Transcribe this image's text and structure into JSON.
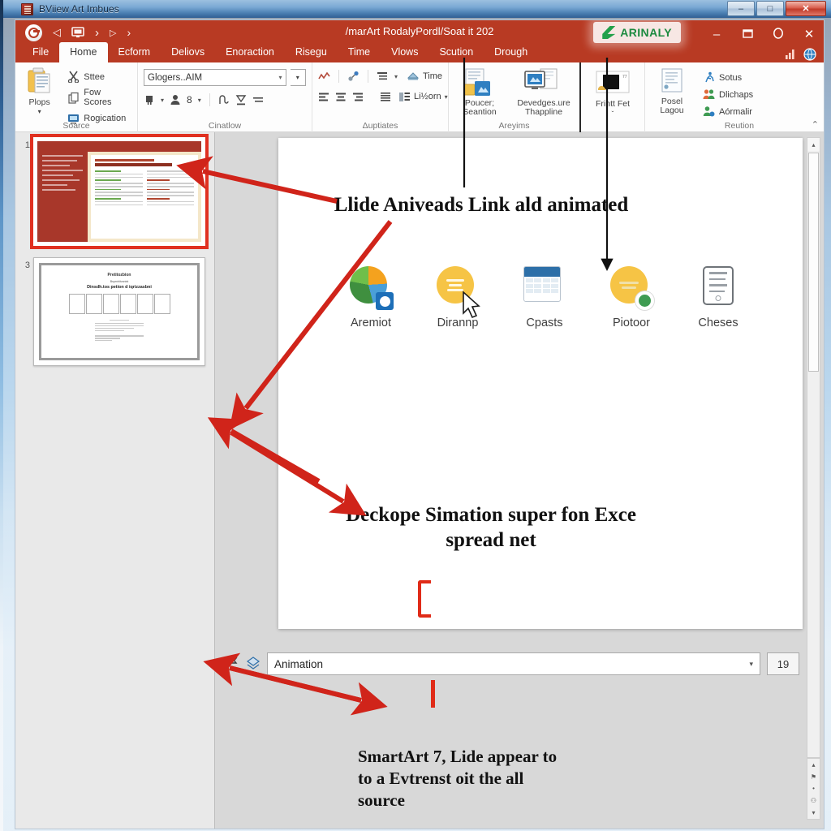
{
  "os_window": {
    "title": "BViiew Art Imbues",
    "icon": "app-icon",
    "buttons": [
      {
        "name": "minimize",
        "glyph": "–"
      },
      {
        "name": "maximize",
        "glyph": "□"
      },
      {
        "name": "close",
        "glyph": "✕"
      }
    ]
  },
  "ribbon": {
    "document_title": "/marArt RodalyPordl/Soat it 202",
    "account_badge": {
      "label": "ARINALY",
      "color": "#1c8a3f"
    },
    "quick_access": [
      {
        "name": "ppt-logo-icon",
        "glyph": ""
      },
      {
        "name": "undo-icon",
        "glyph": "◁"
      },
      {
        "name": "present-icon",
        "glyph": "⬜"
      },
      {
        "name": "redo-icon",
        "glyph": "›"
      },
      {
        "name": "slideshow-icon",
        "glyph": "▷"
      },
      {
        "name": "more-icon",
        "glyph": "›"
      }
    ],
    "window_controls": [
      {
        "name": "minimize-icon",
        "glyph": "–"
      },
      {
        "name": "restore-icon",
        "glyph": "❐"
      },
      {
        "name": "help-icon",
        "glyph": "◌"
      },
      {
        "name": "close-icon",
        "glyph": "✕"
      }
    ],
    "tabs": [
      {
        "label": "File",
        "active": false
      },
      {
        "label": "Home",
        "active": true
      },
      {
        "label": "Ecform",
        "active": false
      },
      {
        "label": "Deliovs",
        "active": false
      },
      {
        "label": "Enoraction",
        "active": false
      },
      {
        "label": "Risegu",
        "active": false
      },
      {
        "label": "Time",
        "active": false
      },
      {
        "label": "Vlows",
        "active": false
      },
      {
        "label": "Scution",
        "active": false
      },
      {
        "label": "Drough",
        "active": false
      }
    ],
    "collapse_glyph": "⌃",
    "groups": [
      {
        "name": "source",
        "label": "Soarce",
        "big_button": {
          "label": "Plops",
          "caret": "▾"
        },
        "items": [
          {
            "label": "Sttee",
            "icon": "cut-icon"
          },
          {
            "label": "Fow Scores",
            "icon": "copy-icon"
          },
          {
            "label": "Rogication",
            "icon": "paste-icon"
          }
        ]
      },
      {
        "name": "cinatlow",
        "label": "Cinatlow",
        "combo_value": "Glogers..AIM",
        "combo_caret": "▾",
        "combo_more": "▾",
        "tools": [
          "bold-icon",
          "caret-icon",
          "person-icon",
          "size-icon",
          "caret-icon",
          "shape-icon",
          "fill-icon",
          "spacing-icon"
        ]
      },
      {
        "name": "auptiates",
        "label": "Δuptiates",
        "row1": [
          "chart-line-icon",
          "link-icon",
          "list-icon",
          "caret-icon"
        ],
        "row1_text": "Time",
        "row2": [
          "align-left-icon",
          "align-center-icon",
          "align-right-icon",
          "justify-icon",
          "columns-icon"
        ],
        "row2_text": "Li½orn",
        "row2_caret": "▾"
      },
      {
        "name": "areyims",
        "label": "Areyims",
        "buttons": [
          {
            "label": "Poucer; Seantion",
            "icon": "insert-object-icon"
          },
          {
            "label": "Devedges.ure Thappline",
            "icon": "screen-clip-icon"
          }
        ]
      },
      {
        "name": "frint-fet",
        "label": "",
        "buttons": [
          {
            "label": "Frintt Fet",
            "icon": "black-shape-icon",
            "caret": "ˇ"
          }
        ]
      },
      {
        "name": "reution",
        "label": "Reution",
        "big_button": {
          "label": "Posel Lagou"
        },
        "items": [
          {
            "label": "Sotus",
            "icon": "run-icon"
          },
          {
            "label": "Dlichaps",
            "icon": "people-icon"
          },
          {
            "label": "Aórmalir",
            "icon": "person-gear-icon"
          }
        ]
      }
    ]
  },
  "thumbnails": [
    {
      "number": "1",
      "selected": true,
      "style": "red-sidebar-deck"
    },
    {
      "number": "3",
      "selected": false,
      "style": "white-table-deck"
    }
  ],
  "slide": {
    "annotation_top": "Llide Aniveads Link ald animated",
    "annotation_mid": "Deckope Simation super fon Exce spread net",
    "icon_row": [
      {
        "caption": "Aremiot",
        "icon": "pie-chart-icon"
      },
      {
        "caption": "Dirannp",
        "icon": "yellow-document-icon"
      },
      {
        "caption": "Cpasts",
        "icon": "calendar-icon"
      },
      {
        "caption": "Piotoor",
        "icon": "globe-badge-icon"
      },
      {
        "caption": "Cheses",
        "icon": "tablet-icon"
      }
    ],
    "cursor": "mouse-pointer"
  },
  "animation_bar": {
    "left_icons": [
      "flag-icon",
      "layers-icon"
    ],
    "value": "Animation",
    "caret": "▾",
    "count": "19"
  },
  "annotation_bottom": "SmartArt 7, Lide appear to to a Evtrenst oit the all source",
  "scrollbars": {
    "slide_up": "▴",
    "slide_down": "▾",
    "nav_prev": "▴",
    "nav_mid_a": "⚑",
    "nav_mid_b": "•",
    "nav_mid_c": "⚇",
    "nav_next": "▾"
  },
  "colors": {
    "ribbon": "#b83a23",
    "annotation_red": "#d0241a",
    "accent_green": "#1c8a3f"
  }
}
